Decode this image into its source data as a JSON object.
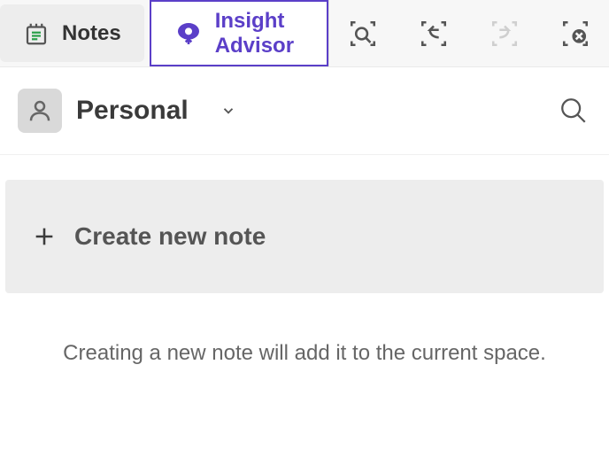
{
  "tabs": {
    "notes_label": "Notes",
    "insight_label": "Insight Advisor"
  },
  "actions": {
    "smart_search": "smart-search",
    "step_back": "step-back",
    "step_forward": "step-forward",
    "clear_selection": "clear-selection"
  },
  "space": {
    "name": "Personal"
  },
  "main": {
    "create_label": "Create new note",
    "hint": "Creating a new note will add it to the current space."
  },
  "colors": {
    "accent": "#5b3fc8"
  }
}
